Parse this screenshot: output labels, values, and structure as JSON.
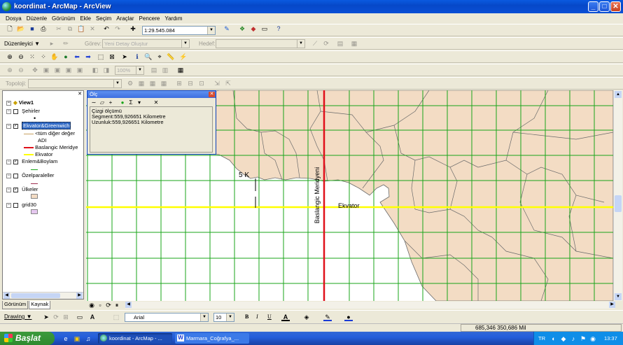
{
  "window": {
    "title": "koordinat - ArcMap - ArcView",
    "minimize": "_",
    "maximize": "□",
    "close": "✕"
  },
  "menu": [
    "Dosya",
    "Düzenle",
    "Görünüm",
    "Ekle",
    "Seçim",
    "Araçlar",
    "Pencere",
    "Yardım"
  ],
  "toolbar_standard": {
    "scale": "1:29.545.084"
  },
  "toolbar_editor": {
    "editor_label": "Düzenleyici ▼",
    "task_label": "Görev:",
    "task_value": "Yeni Detay Oluştur",
    "target_label": "Hedef:"
  },
  "toolbar_layout": {
    "zoom": "100%"
  },
  "toolbar_topology": {
    "label": "Topoloji:"
  },
  "toc": {
    "root": "View1",
    "layers": [
      {
        "name": "Şehirler",
        "checked": false
      },
      {
        "name": "Ekvator&Greenwich",
        "checked": true,
        "selected": true,
        "legend": [
          "<tüm diğer değer",
          "ADI",
          "Baslangic Meridye",
          "Ekvator"
        ]
      },
      {
        "name": "Enlem&Boylam",
        "checked": true
      },
      {
        "name": "Özelparaleller",
        "checked": false
      },
      {
        "name": "Ülkeler",
        "checked": true
      },
      {
        "name": "grid30",
        "checked": false
      }
    ],
    "tabs": [
      "Görünüm",
      "Kaynak"
    ]
  },
  "measure": {
    "title": "Ölç",
    "line_label": "Çizgi ölçümü",
    "segment": "Segment:559,926651 Kilometre",
    "length": "Uzunluk:559,926651 Kilometre"
  },
  "map": {
    "label_5k": "5 K",
    "meridian_label": "Baslangic Meridyeni",
    "equator_label": "Ekvator",
    "colors": {
      "land": "#f3dcc4",
      "border": "#6a6a6a",
      "grid": "#1aa51a",
      "meridian": "#e0101a",
      "equator": "#ffff00",
      "sea": "#ffffff"
    }
  },
  "drawing": {
    "menu": "Drawing ▼",
    "font": "Arial",
    "size": "10",
    "bold": "B",
    "italic": "I",
    "underline": "U"
  },
  "status": {
    "coords": "685,346  350,686 Mil"
  },
  "taskbar": {
    "start": "Başlat",
    "tasks": [
      "koordinat - ArcMap - ...",
      "Marmara_Coğrafya_..."
    ],
    "lang": "TR",
    "clock": "13:37"
  }
}
